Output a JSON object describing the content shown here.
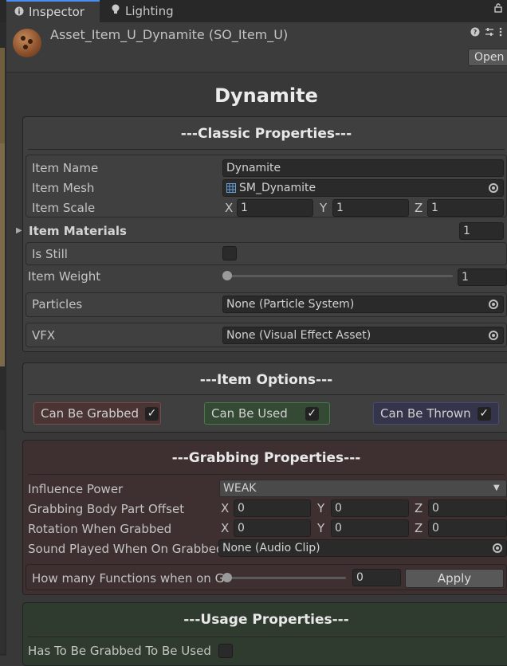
{
  "tabs": [
    {
      "label": "Inspector",
      "icon": "info-icon",
      "active": true
    },
    {
      "label": "Lighting",
      "icon": "lightbulb-icon",
      "active": false
    }
  ],
  "header": {
    "asset_title": "Asset_Item_U_Dynamite (SO_Item_U)",
    "open_label": "Open"
  },
  "item_title": "Dynamite",
  "classic": {
    "title": "---Classic Properties---",
    "item_name_label": "Item Name",
    "item_name_value": "Dynamite",
    "item_mesh_label": "Item Mesh",
    "item_mesh_value": "SM_Dynamite",
    "item_scale_label": "Item Scale",
    "scale": {
      "x_label": "X",
      "x": "1",
      "y_label": "Y",
      "y": "1",
      "z_label": "Z",
      "z": "1"
    },
    "materials_label": "Item Materials",
    "materials_count": "1",
    "is_still_label": "Is Still",
    "is_still_checked": false,
    "weight_label": "Item Weight",
    "weight_value": "1",
    "weight_fraction": 0.0,
    "particles_label": "Particles",
    "particles_value": "None (Particle System)",
    "vfx_label": "VFX",
    "vfx_value": "None (Visual Effect Asset)"
  },
  "options": {
    "title": "---Item Options---",
    "grabbed": {
      "label": "Can Be Grabbed",
      "checked": true,
      "bg": "#4a3434",
      "border": "#7a4a4a"
    },
    "used": {
      "label": "Can Be Used",
      "checked": true,
      "bg": "#344a34",
      "border": "#4a7a4a"
    },
    "thrown": {
      "label": "Can Be Thrown",
      "checked": true,
      "bg": "#34344a",
      "border": "#4a4a7a"
    }
  },
  "grabbing": {
    "title": "---Grabbing Properties---",
    "bg": "#3e3030",
    "influence_label": "Influence Power",
    "influence_value": "WEAK",
    "offset_label": "Grabbing Body Part Offset",
    "offset": {
      "x_label": "X",
      "x": "0",
      "y_label": "Y",
      "y": "0",
      "z_label": "Z",
      "z": "0"
    },
    "rotation_label": "Rotation When Grabbed",
    "rotation": {
      "x_label": "X",
      "x": "0",
      "y_label": "Y",
      "y": "0",
      "z_label": "Z",
      "z": "0"
    },
    "sound_label": "Sound Played When On Grabbed",
    "sound_value": "None (Audio Clip)",
    "functions_label": "How many Functions when on Gr",
    "functions_value": "0",
    "functions_fraction": 0.0,
    "apply_label": "Apply"
  },
  "usage": {
    "title": "---Usage Properties---",
    "bg": "#2f3b2f",
    "has_to_be_grabbed_label": "Has To Be Grabbed To Be Used",
    "has_to_be_grabbed_checked": false
  }
}
